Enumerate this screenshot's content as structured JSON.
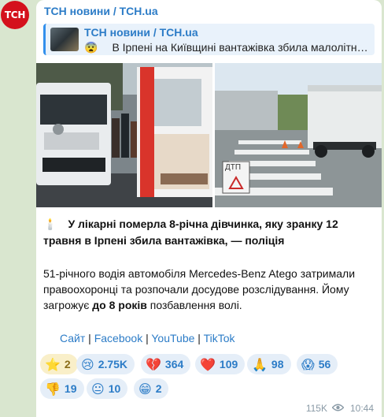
{
  "avatar_text": "ТСН",
  "channel_name": "ТСН новини / TCH.ua",
  "reply": {
    "title": "ТСН новини / TCH.ua",
    "emoji": "😨",
    "text": "В Ірпені на Київщині вантажівка збила малолітню дитину"
  },
  "photo_right_sign": "ДТП",
  "headline_emoji": "🕯️",
  "headline": "У лікарні померла 8-річна дівчинка, яку зранку 12 травня в Ірпені збила вантажівка, — поліція",
  "body": {
    "part1": "51-річного водія автомобіля Mercedes-Benz Atego затримали правоохоронці та розпочали досудове розслідування. Йому загрожує ",
    "bold": "до 8 років",
    "part2": " позбавлення волі."
  },
  "links": [
    "Сайт",
    "Facebook",
    "YouTube",
    "TikTok"
  ],
  "reactions_row1": [
    {
      "emoji": "⭐",
      "count": "2"
    },
    {
      "emoji": "😢",
      "count": "2.75K"
    },
    {
      "emoji": "💔",
      "count": "364"
    },
    {
      "emoji": "❤️",
      "count": "109"
    },
    {
      "emoji": "🙏",
      "count": "98"
    },
    {
      "emoji": "😱",
      "count": "56"
    }
  ],
  "reactions_row2": [
    {
      "emoji": "👎",
      "count": "19"
    },
    {
      "emoji": "😐",
      "count": "10"
    },
    {
      "emoji": "😁",
      "count": "2"
    }
  ],
  "views": "115K",
  "time": "10:44",
  "colors": {
    "accent": "#2c7cc7",
    "brand_red": "#d4111c",
    "chat_bg": "#d9e6cf"
  }
}
